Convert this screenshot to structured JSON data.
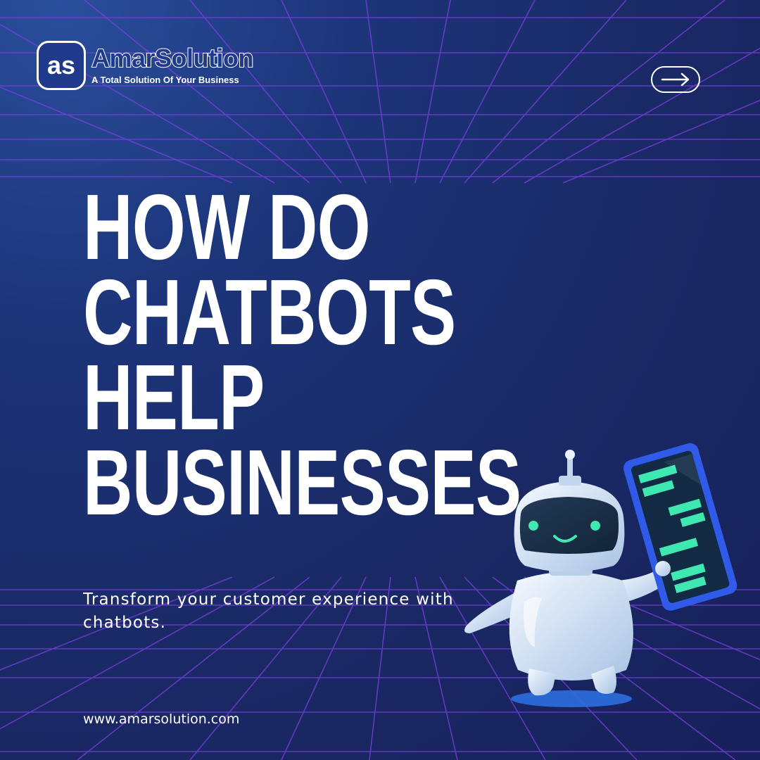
{
  "brand": {
    "logo_mark": "as",
    "name": "AmarSolution",
    "tagline": "A Total Solution Of Your Business"
  },
  "nav": {
    "next_icon": "arrow-right-icon"
  },
  "headline": {
    "lines": [
      "HOW DO",
      "CHATBOTS",
      "HELP",
      "BUSINESSES"
    ]
  },
  "subtitle": "Transform your customer experience with chatbots.",
  "website": "www.amarsolution.com",
  "colors": {
    "background": "#1a2a66",
    "grid_line": "#7b3fe0",
    "tablet_screen_text": "#3ee8b0",
    "tablet_frame": "#2f5be8",
    "robot_body": "#dbe8f7"
  }
}
